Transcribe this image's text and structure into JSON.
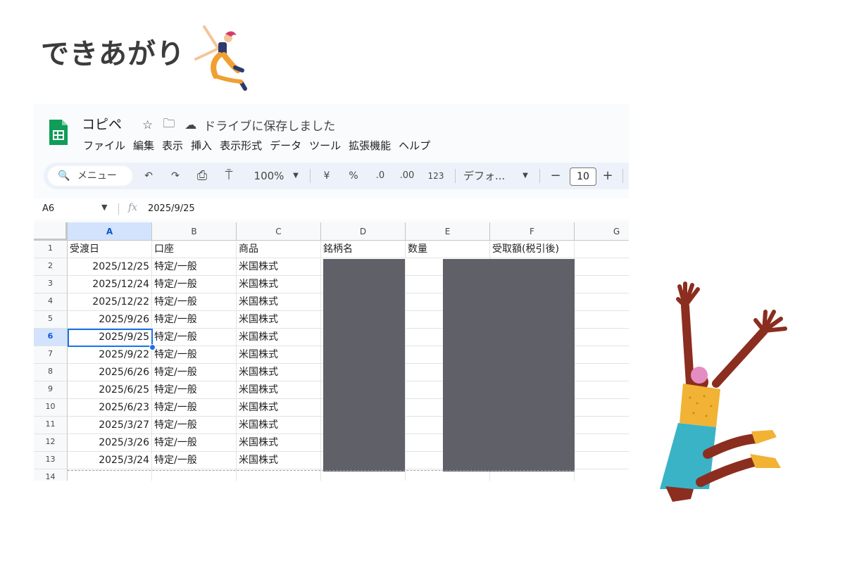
{
  "headline": "できあがり",
  "sheets": {
    "doc_title": "コピペ",
    "title_icons": [
      "star-icon",
      "move-to-folder-icon",
      "cloud-saved-icon"
    ],
    "save_status": "ドライブに保存しました",
    "menu": [
      "ファイル",
      "編集",
      "表示",
      "挿入",
      "表示形式",
      "データ",
      "ツール",
      "拡張機能",
      "ヘルプ"
    ],
    "toolbar": {
      "search_label": "メニュー",
      "undo_icon": "↶",
      "redo_icon": "↷",
      "print_icon": "⎙",
      "paint_format_icon": "⍑",
      "zoom": "100%",
      "currency": "¥",
      "percent": "%",
      "decrease_decimal": ".0",
      "increase_decimal": ".00",
      "number_format": "123",
      "font": "デフォ...",
      "minus": "−",
      "font_size": "10",
      "plus": "+"
    },
    "formula_bar": {
      "name_box": "A6",
      "fx": "fx",
      "value": "2025/9/25"
    },
    "columns": [
      "A",
      "B",
      "C",
      "D",
      "E",
      "F",
      "G"
    ],
    "selected_column": "A",
    "selected_row": "6",
    "row_numbers": [
      "1",
      "2",
      "3",
      "4",
      "5",
      "6",
      "7",
      "8",
      "9",
      "10",
      "11",
      "12",
      "13",
      "14"
    ],
    "header_row": [
      "受渡日",
      "口座",
      "商品",
      "銘柄名",
      "数量",
      "受取額(税引後)"
    ],
    "rows": [
      {
        "date": "2025/12/25",
        "account": "特定/一般",
        "product": "米国株式"
      },
      {
        "date": "2025/12/24",
        "account": "特定/一般",
        "product": "米国株式"
      },
      {
        "date": "2025/12/22",
        "account": "特定/一般",
        "product": "米国株式"
      },
      {
        "date": "2025/9/26",
        "account": "特定/一般",
        "product": "米国株式"
      },
      {
        "date": "2025/9/25",
        "account": "特定/一般",
        "product": "米国株式"
      },
      {
        "date": "2025/9/22",
        "account": "特定/一般",
        "product": "米国株式"
      },
      {
        "date": "2025/6/26",
        "account": "特定/一般",
        "product": "米国株式"
      },
      {
        "date": "2025/6/25",
        "account": "特定/一般",
        "product": "米国株式"
      },
      {
        "date": "2025/6/23",
        "account": "特定/一般",
        "product": "米国株式"
      },
      {
        "date": "2025/3/27",
        "account": "特定/一般",
        "product": "米国株式"
      },
      {
        "date": "2025/3/26",
        "account": "特定/一般",
        "product": "米国株式"
      },
      {
        "date": "2025/3/24",
        "account": "特定/一般",
        "product": "米国株式"
      }
    ],
    "colors": {
      "accent": "#1a73e8",
      "redaction": "#5f6068",
      "sheets_green": "#0f9d58"
    }
  }
}
